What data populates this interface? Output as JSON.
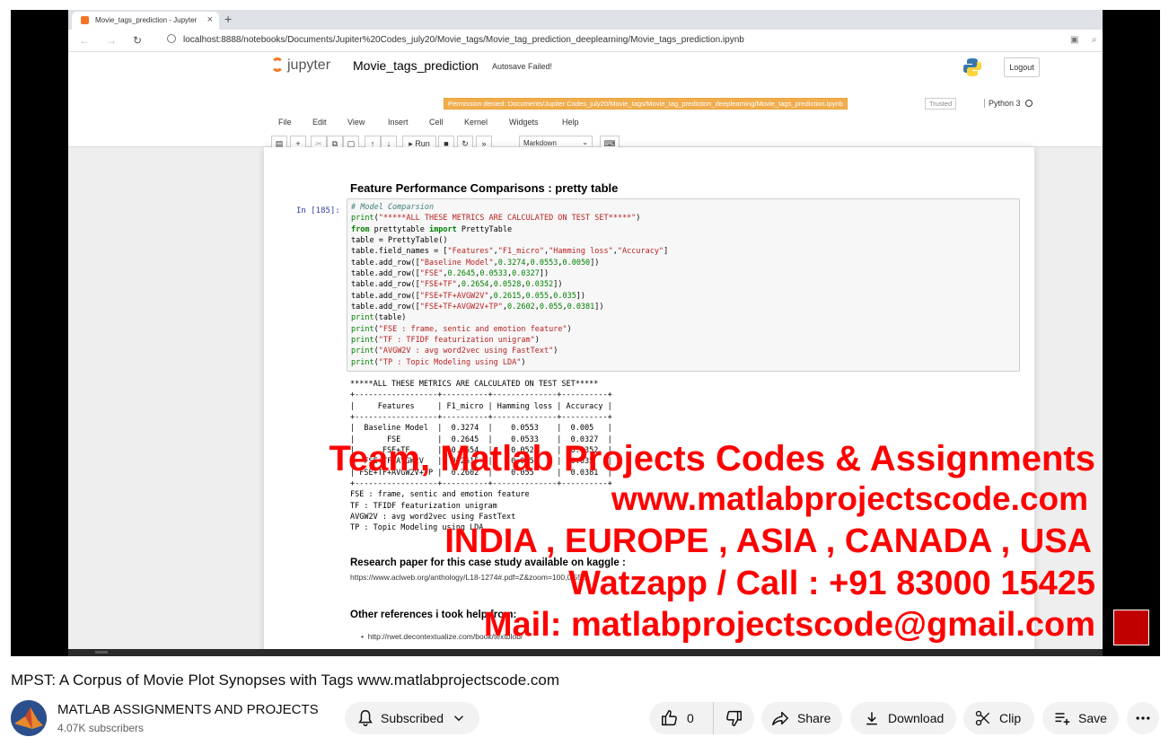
{
  "browser": {
    "tab_title": "Movie_tags_prediction - Jupyter",
    "tab_close": "×",
    "new_tab": "+",
    "url": "localhost:8888/notebooks/Documents/Jupiter%20Codes_july20/Movie_tags/Movie_tag_prediction_deeplearning/Movie_tags_prediction.ipynb"
  },
  "jupyter": {
    "logo_text": "jupyter",
    "notebook_name": "Movie_tags_prediction",
    "autosave": "Autosave Failed!",
    "logout": "Logout",
    "permission_msg": "Permission denied: Documents/Jupiter Codes_july20/Movie_tags/Movie_tag_prediction_deeplearning/Movie_tags_prediction.ipynb",
    "trusted": "Trusted",
    "kernel": "Python 3",
    "menu": [
      "File",
      "Edit",
      "View",
      "Insert",
      "Cell",
      "Kernel",
      "Widgets",
      "Help"
    ],
    "run_label": "Run",
    "cell_type": "Markdown"
  },
  "notebook": {
    "section_title": "Feature Performance Comparisons : pretty table",
    "prompt": "In [185]:",
    "code_lines": [
      "# Model Comparsion",
      "print(\"*****ALL THESE METRICS ARE CALCULATED ON TEST SET*****\")",
      "from prettytable import PrettyTable",
      "table = PrettyTable()",
      "table.field_names = [\"Features\",\"F1_micro\",\"Hamming loss\",\"Accuracy\"]",
      "table.add_row([\"Baseline Model\",0.3274,0.0553,0.0050])",
      "table.add_row([\"FSE\",0.2645,0.0533,0.0327])",
      "table.add_row([\"FSE+TF\",0.2654,0.0528,0.0352])",
      "table.add_row([\"FSE+TF+AVGW2V\",0.2615,0.055,0.035])",
      "table.add_row([\"FSE+TF+AVGW2V+TP\",0.2602,0.055,0.0381])",
      "print(table)",
      "print(\"FSE : frame, sentic and emotion feature\")",
      "print(\"TF : TFIDF featurization unigram\")",
      "print(\"AVGW2V : avg word2vec using FastText\")",
      "print(\"TP : Topic Modeling using LDA\")"
    ],
    "output_lines": [
      "*****ALL THESE METRICS ARE CALCULATED ON TEST SET*****",
      "+------------------+----------+--------------+----------+",
      "|     Features     | F1_micro | Hamming loss | Accuracy |",
      "+------------------+----------+--------------+----------+",
      "|  Baseline Model  |  0.3274  |    0.0553    |  0.005   |",
      "|       FSE        |  0.2645  |    0.0533    |  0.0327  |",
      "|      FSE+TF      |  0.2654  |    0.0528    |  0.0352  |",
      "|  FSE+TF+AVGW2V   |  0.2615  |    0.055     |  0.035   |",
      "| FSE+TF+AVGW2V+TP |  0.2602  |    0.055     |  0.0381  |",
      "+------------------+----------+--------------+----------+",
      "FSE : frame, sentic and emotion feature",
      "TF : TFIDF featurization unigram",
      "AVGW2V : avg word2vec using FastText",
      "TP : Topic Modeling using LDA"
    ],
    "research_title": "Research paper for this case study available on kaggle :",
    "research_url": "https://www.aclweb.org/anthology/L18-1274#.pdf=Z&zoom=100,0,553",
    "other_title": "Other references i took help from:",
    "other_items": [
      "http://rwet.decontextualize.com/book/textblob/"
    ]
  },
  "watermark": {
    "line1": "Team, Matlab Projects Codes & Assignments",
    "line2": "www.matlabprojectscode.com",
    "line3": "INDIA , EUROPE , ASIA , CANADA , USA",
    "line4": "Watzapp / Call : +91 83000 15425",
    "line5": "Mail: matlabprojectscode@gmail.com"
  },
  "video": {
    "title": "MPST: A Corpus of Movie Plot Synopses with Tags www.matlabprojectscode.com",
    "channel": "MATLAB ASSIGNMENTS AND PROJECTS",
    "subscribers": "4.07K subscribers",
    "subscribe_label": "Subscribed",
    "like_count": "0",
    "share": "Share",
    "download": "Download",
    "clip": "Clip",
    "save": "Save"
  },
  "colors": {
    "watermark_red": "#ff0000",
    "jupyter_orange": "#f37726",
    "warning_orange": "#f0ad4e"
  }
}
